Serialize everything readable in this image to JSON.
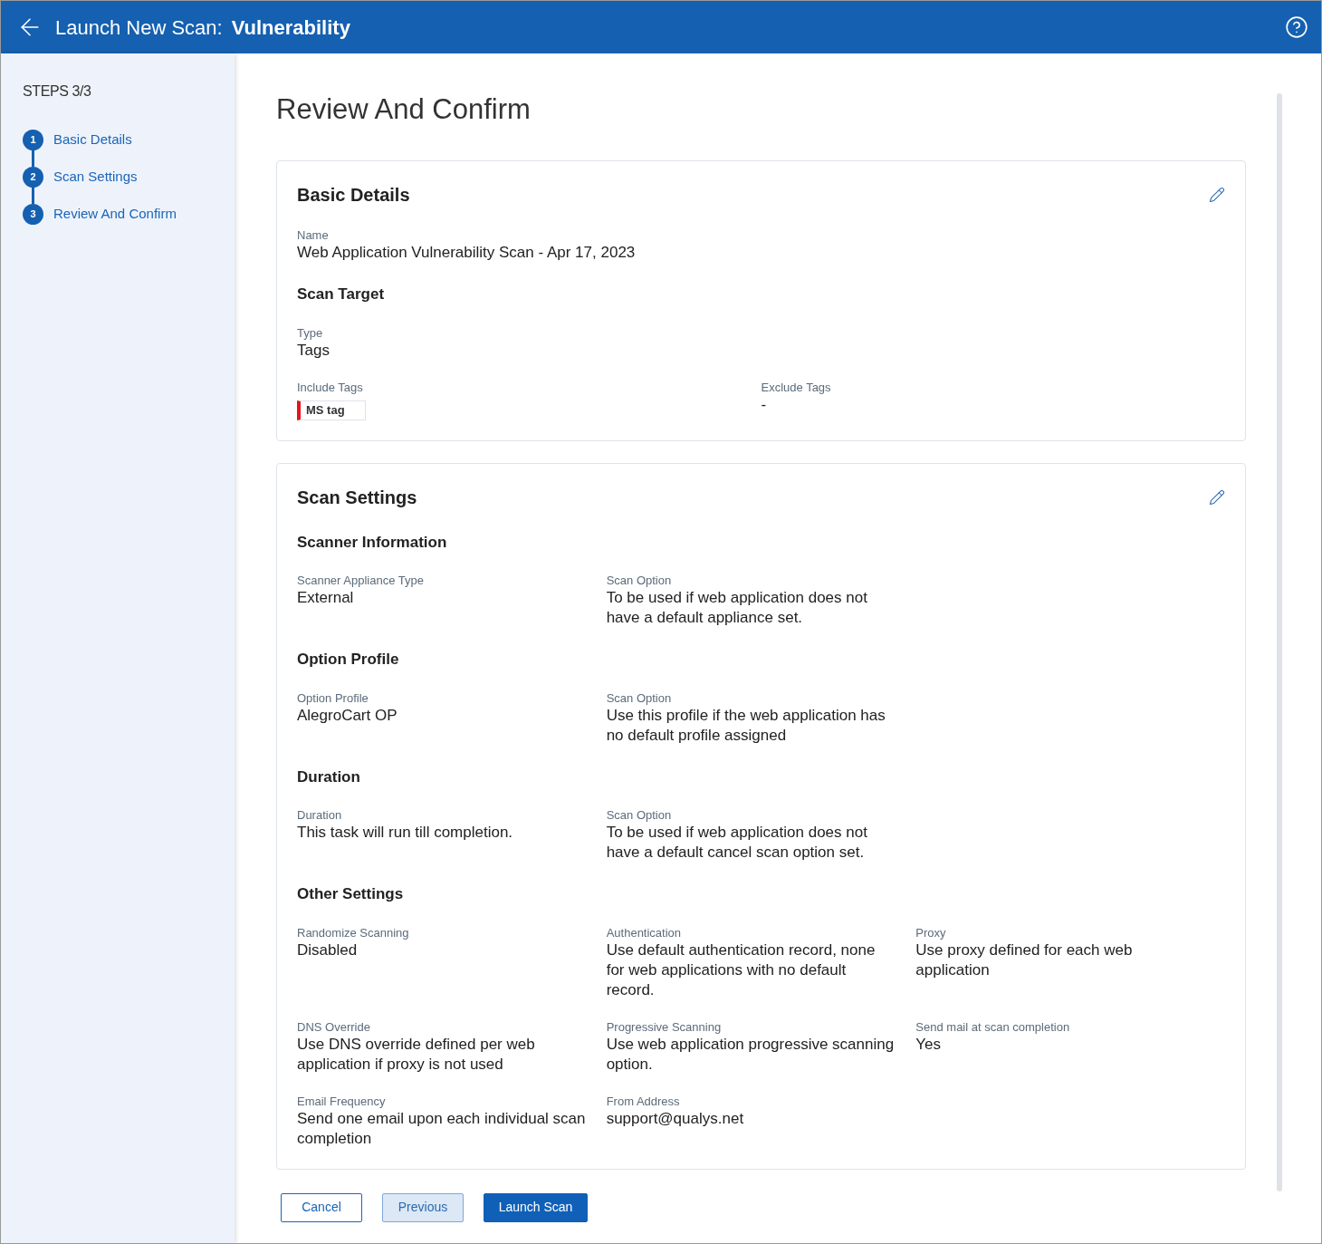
{
  "header": {
    "title": "Launch New Scan:",
    "subtitle": "Vulnerability"
  },
  "steps": {
    "label": "STEPS 3/3",
    "items": [
      {
        "number": "1",
        "label": "Basic Details"
      },
      {
        "number": "2",
        "label": "Scan Settings"
      },
      {
        "number": "3",
        "label": "Review And Confirm"
      }
    ]
  },
  "page_title": "Review And Confirm",
  "cards": [
    {
      "title": "Basic Details",
      "groups": [
        {
          "fields": [
            {
              "label": "Name",
              "value": "Web Application Vulnerability Scan - Apr 17, 2023"
            }
          ]
        },
        {
          "heading": "Scan Target",
          "fields": [
            {
              "label": "Type",
              "value": "Tags"
            }
          ]
        },
        {
          "fields": [
            {
              "label": "Include Tags",
              "kind": "tags",
              "tags": [
                {
                  "label": "MS tag",
                  "color": "#e8141b"
                }
              ]
            },
            {
              "label": "Exclude Tags",
              "kind": "text",
              "value": "-"
            }
          ]
        }
      ]
    },
    {
      "title": "Scan Settings",
      "groups": [
        {
          "heading": "Scanner Information",
          "fields": [
            {
              "label": "Scanner Appliance Type",
              "value": "External"
            },
            {
              "label": "Scan Option",
              "value": "To be used if web application does not have a default appliance set."
            }
          ]
        },
        {
          "heading": "Option Profile",
          "fields": [
            {
              "label": "Option Profile",
              "value": "AlegroCart OP"
            },
            {
              "label": "Scan Option",
              "value": "Use this profile if the web application has no default profile assigned"
            }
          ]
        },
        {
          "heading": "Duration",
          "fields": [
            {
              "label": "Duration",
              "value": "This task will run till completion."
            },
            {
              "label": "Scan Option",
              "value": "To be used if web application does not have a default cancel scan option set."
            }
          ]
        },
        {
          "heading": "Other Settings",
          "fields": [
            {
              "label": "Randomize Scanning",
              "value": "Disabled"
            },
            {
              "label": "Authentication",
              "value": "Use default authentication record, none for web applications with no default record."
            },
            {
              "label": "Proxy",
              "value": "Use proxy defined for each web application"
            },
            {
              "label": "DNS Override",
              "value": "Use DNS override defined per web application if proxy is not used"
            },
            {
              "label": "Progressive Scanning",
              "value": "Use web application progressive scanning option."
            },
            {
              "label": "Send mail at scan completion",
              "value": "Yes"
            },
            {
              "label": "Email Frequency",
              "value": "Send one email upon each individual scan completion"
            },
            {
              "label": "From Address",
              "value": "support@qualys.net"
            }
          ]
        }
      ]
    }
  ],
  "buttons": [
    {
      "label": "Cancel",
      "kind": "outline"
    },
    {
      "label": "Previous",
      "kind": "secondary"
    },
    {
      "label": "Launch Scan",
      "kind": "primary"
    }
  ]
}
